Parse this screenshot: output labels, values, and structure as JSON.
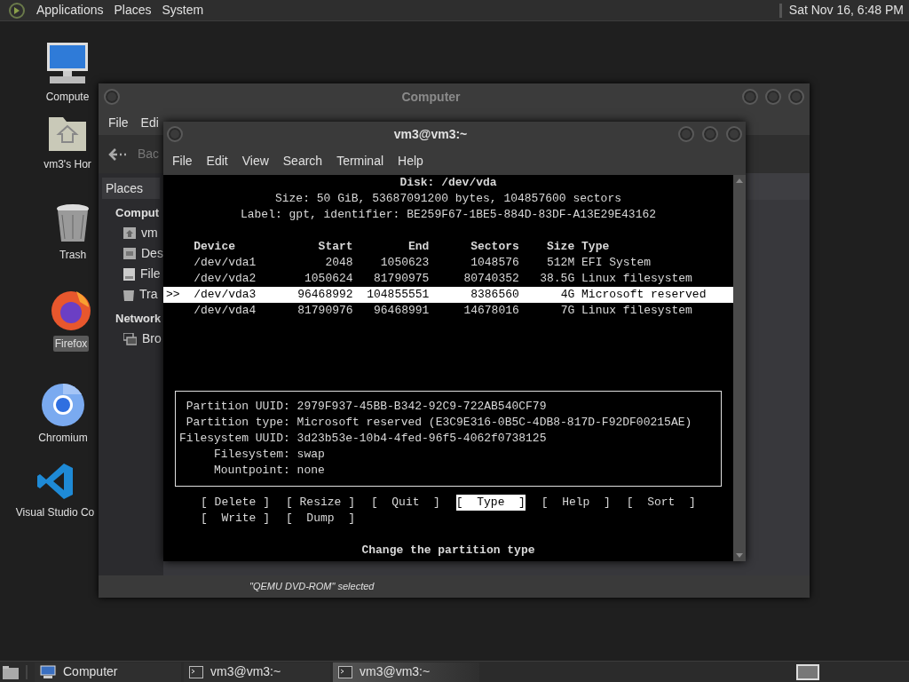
{
  "top_panel": {
    "menus": [
      "Applications",
      "Places",
      "System"
    ],
    "clock": "Sat Nov 16, 6:48 PM"
  },
  "desktop_icons": [
    {
      "label": "Compute",
      "kind": "computer",
      "selected": false
    },
    {
      "label": "vm3's Hor",
      "kind": "home",
      "selected": false
    },
    {
      "label": "Trash",
      "kind": "trash",
      "selected": false
    },
    {
      "label": "Firefox",
      "kind": "firefox",
      "selected": true
    },
    {
      "label": "Chromium",
      "kind": "chromium",
      "selected": false
    },
    {
      "label": "Visual Studio Co",
      "kind": "vscode",
      "selected": false
    }
  ],
  "file_manager": {
    "title": "Computer",
    "menu": [
      "File",
      "Edi"
    ],
    "back_button": "Bac",
    "sidebar": {
      "header": "Places",
      "sections": [
        {
          "title": "Comput",
          "items": [
            {
              "label": "vm",
              "kind": "home"
            },
            {
              "label": "Des",
              "kind": "desktop"
            },
            {
              "label": "File",
              "kind": "filesystem"
            },
            {
              "label": "Tra",
              "kind": "trash"
            }
          ]
        },
        {
          "title": "Network",
          "items": [
            {
              "label": "Bro",
              "kind": "network"
            }
          ]
        }
      ]
    },
    "status": "\"QEMU DVD-ROM\" selected"
  },
  "terminal": {
    "title": "vm3@vm3:~",
    "menu": [
      "File",
      "Edit",
      "View",
      "Search",
      "Terminal",
      "Help"
    ],
    "disk_header": "Disk: /dev/vda",
    "disk_info": [
      "Size: 50 GiB, 53687091200 bytes, 104857600 sectors",
      "Label: gpt, identifier: BE259F67-1BE5-884D-83DF-A13E29E43162"
    ],
    "table": {
      "cursor": ">>",
      "columns": [
        "Device",
        "Start",
        "End",
        "Sectors",
        "Size",
        "Type"
      ],
      "rows": [
        {
          "cells": [
            "/dev/vda1",
            "2048",
            "1050623",
            "1048576",
            "512M",
            "EFI System"
          ],
          "selected": false
        },
        {
          "cells": [
            "/dev/vda2",
            "1050624",
            "81790975",
            "80740352",
            "38.5G",
            "Linux filesystem"
          ],
          "selected": false
        },
        {
          "cells": [
            "/dev/vda3",
            "96468992",
            "104855551",
            "8386560",
            "4G",
            "Microsoft reserved"
          ],
          "selected": true
        },
        {
          "cells": [
            "/dev/vda4",
            "81790976",
            "96468991",
            "14678016",
            "7G",
            "Linux filesystem"
          ],
          "selected": false
        }
      ]
    },
    "details": [
      {
        "label": "Partition UUID:",
        "value": "2979F937-45BB-B342-92C9-722AB540CF79"
      },
      {
        "label": "Partition type:",
        "value": "Microsoft reserved (E3C9E316-0B5C-4DB8-817D-F92DF00215AE)"
      },
      {
        "label": "Filesystem UUID:",
        "value": "3d23b53e-10b4-4fed-96f5-4062f0738125"
      },
      {
        "label": "Filesystem:",
        "value": "swap"
      },
      {
        "label": "Mountpoint:",
        "value": "none"
      }
    ],
    "actions": [
      {
        "label": "[ Delete ]",
        "selected": false
      },
      {
        "label": "[ Resize ]",
        "selected": false
      },
      {
        "label": "[  Quit  ]",
        "selected": false
      },
      {
        "label": "[  Type  ]",
        "selected": true
      },
      {
        "label": "[  Help  ]",
        "selected": false
      },
      {
        "label": "[  Sort  ]",
        "selected": false
      },
      {
        "label": "[  Write ]",
        "selected": false
      },
      {
        "label": "[  Dump  ]",
        "selected": false
      }
    ],
    "hint": "Change the partition type"
  },
  "taskbar": {
    "items": [
      {
        "label": "Computer",
        "kind": "file-manager",
        "selected": false
      },
      {
        "label": "vm3@vm3:~",
        "kind": "terminal",
        "selected": false
      },
      {
        "label": "vm3@vm3:~",
        "kind": "terminal",
        "selected": true
      }
    ]
  }
}
